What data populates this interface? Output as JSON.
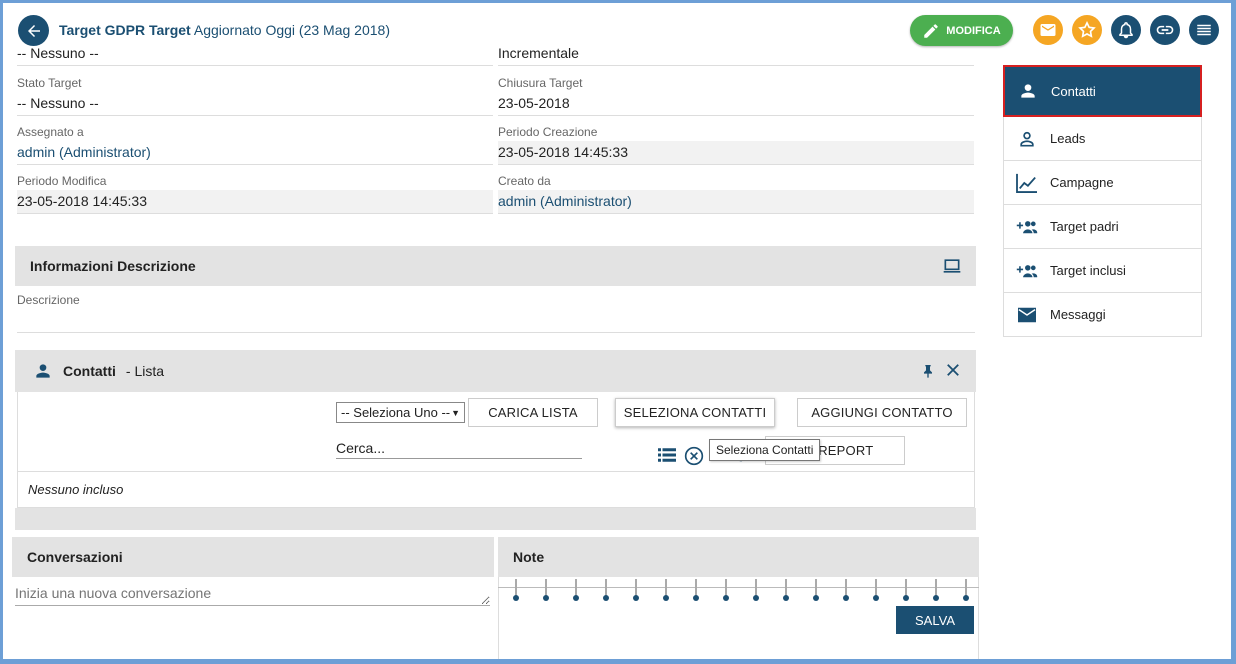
{
  "header": {
    "title": "Target GDPR Target",
    "subtitle": "Aggiornato Oggi (23 Mag 2018)",
    "edit_label": "MODIFICA"
  },
  "details": {
    "partial_left": "-- Nessuno --",
    "partial_right": "Incrementale",
    "rows": [
      {
        "left_label": "Stato Target",
        "left_value": "-- Nessuno --",
        "right_label": "Chiusura Target",
        "right_value": "23-05-2018"
      },
      {
        "left_label": "Assegnato a",
        "left_value": "admin (Administrator)",
        "right_label": "Periodo Creazione",
        "right_value": "23-05-2018 14:45:33"
      },
      {
        "left_label": "Periodo Modifica",
        "left_value": "23-05-2018 14:45:33",
        "right_label": "Creato da",
        "right_value": "admin (Administrator)"
      }
    ]
  },
  "description_block": {
    "title": "Informazioni Descrizione",
    "field_label": "Descrizione",
    "field_value": ""
  },
  "contacts_block": {
    "title": "Contatti",
    "subtitle": "- Lista",
    "select_value": "-- Seleziona Uno --",
    "load_list_label": "CARICA LISTA",
    "select_contacts_label": "SELEZIONA CONTATTI",
    "add_contact_label": "AGGIUNGI CONTATTO",
    "search_placeholder": "Cerca...",
    "report_label": "CA REPORT",
    "tooltip": "Seleziona Contatti",
    "empty_text": "Nessuno incluso"
  },
  "conversations": {
    "title": "Conversazioni",
    "placeholder": "Inizia una nuova conversazione"
  },
  "notes": {
    "title": "Note",
    "save_label": "SALVA"
  },
  "sidebar": {
    "items": [
      {
        "label": "Contatti",
        "icon": "person-icon"
      },
      {
        "label": "Leads",
        "icon": "person-outline-icon"
      },
      {
        "label": "Campagne",
        "icon": "trend-chart-icon"
      },
      {
        "label": "Target padri",
        "icon": "group-add-icon"
      },
      {
        "label": "Target inclusi",
        "icon": "group-add-icon"
      },
      {
        "label": "Messaggi",
        "icon": "mail-icon"
      }
    ]
  },
  "colors": {
    "primary": "#1b4f72",
    "edit_green": "#4caf50",
    "accent_orange": "#f5a623",
    "active_border": "#d62020"
  }
}
